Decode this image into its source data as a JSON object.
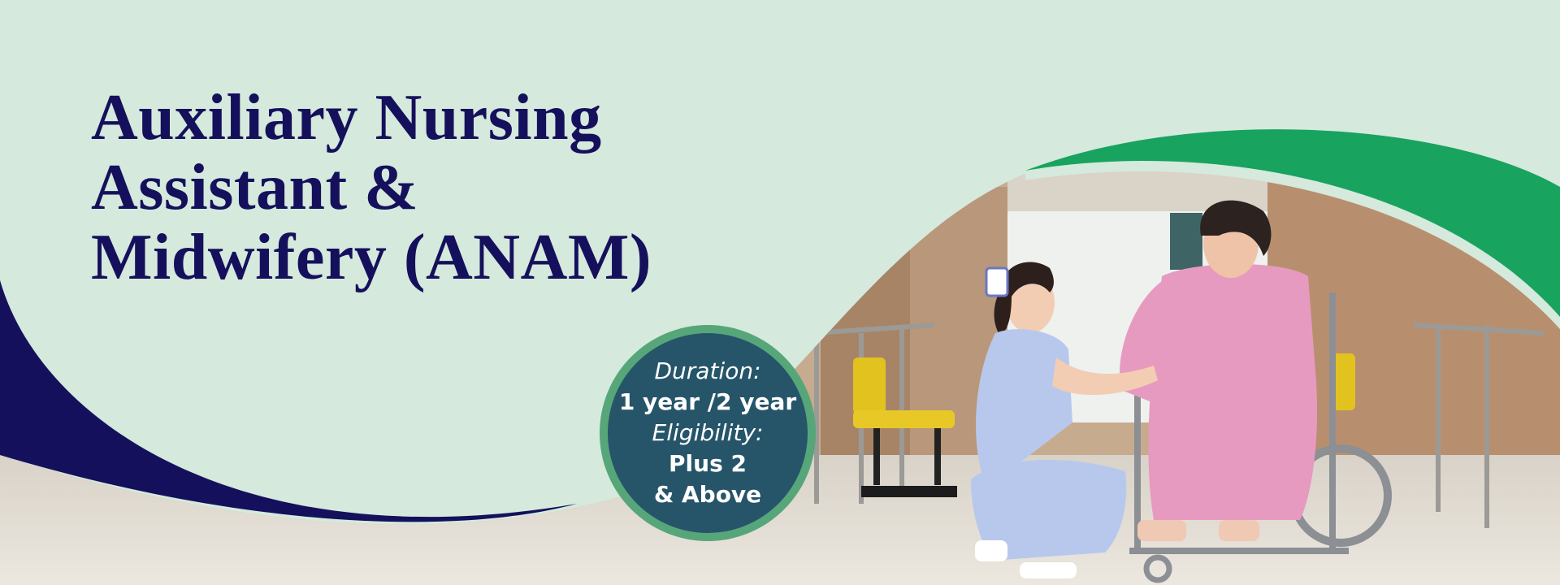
{
  "banner": {
    "title_lines": [
      "Auxiliary Nursing",
      "Assistant &",
      "Midwifery (ANAM)"
    ],
    "badge": {
      "duration_label": "Duration:",
      "duration_value": "1 year /2 year",
      "eligibility_label": "Eligibility:",
      "eligibility_value_line1": "Plus 2",
      "eligibility_value_line2": "& Above"
    },
    "colors": {
      "background": "#d5e9dc",
      "title": "#15105c",
      "navy_swoosh": "#15105c",
      "green_swoosh": "#18a35f",
      "badge_ring": "#56a67a",
      "badge_fill": "#1e4868"
    }
  }
}
